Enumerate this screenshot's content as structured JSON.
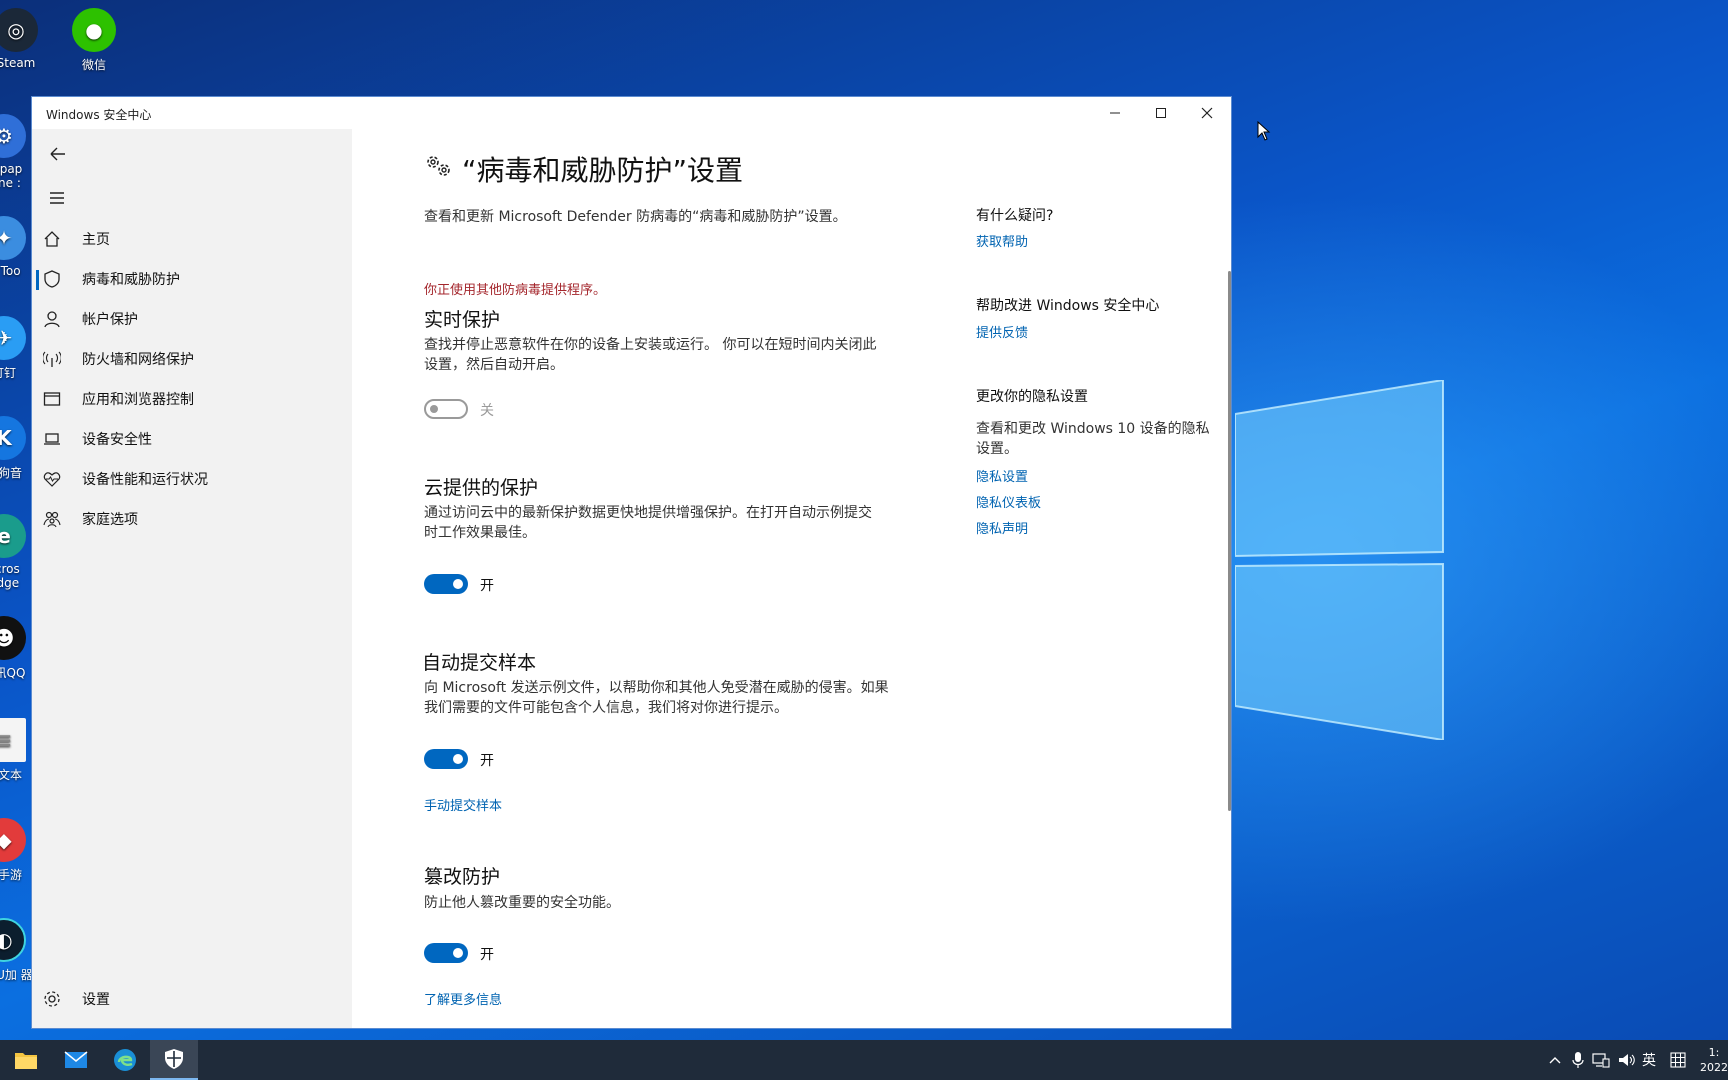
{
  "desktop": {
    "icons": [
      {
        "label": "Steam"
      },
      {
        "label": "微信"
      },
      {
        "label": "allpap gine :"
      },
      {
        "label": "tt Too"
      },
      {
        "label": "钉钉"
      },
      {
        "label": "酷狗音"
      },
      {
        "label": "licros Edge"
      },
      {
        "label": "腾讯QQ"
      },
      {
        "label": "建文本"
      },
      {
        "label": "讯手游"
      },
      {
        "label": "易UU加 器"
      }
    ]
  },
  "window": {
    "title": "Windows 安全中心"
  },
  "sidebar": {
    "items": [
      {
        "label": "主页",
        "icon": "home-icon"
      },
      {
        "label": "病毒和威胁防护",
        "icon": "shield-icon"
      },
      {
        "label": "帐户保护",
        "icon": "person-icon"
      },
      {
        "label": "防火墙和网络保护",
        "icon": "antenna-icon"
      },
      {
        "label": "应用和浏览器控制",
        "icon": "browser-window-icon"
      },
      {
        "label": "设备安全性",
        "icon": "laptop-icon"
      },
      {
        "label": "设备性能和运行状况",
        "icon": "heart-pulse-icon"
      },
      {
        "label": "家庭选项",
        "icon": "family-icon"
      }
    ],
    "settings_label": "设置"
  },
  "main": {
    "title": "“病毒和威胁防护”设置",
    "subtitle": "查看和更新 Microsoft Defender 防病毒的“病毒和威胁防护”设置。",
    "warning": "你正使用其他防病毒提供程序。",
    "sections": [
      {
        "title": "实时保护",
        "desc_line1": "查找并停止恶意软件在你的设备上安装或运行。 你可以在短时间内关闭此",
        "desc_line2": "设置，然后自动开启。",
        "state": "关",
        "on": false
      },
      {
        "title": "云提供的保护",
        "desc_line1": "通过访问云中的最新保护数据更快地提供增强保护。在打开自动示例提交",
        "desc_line2": "时工作效果最佳。",
        "state": "开",
        "on": true
      },
      {
        "title": "自动提交样本",
        "desc_line1": "向 Microsoft 发送示例文件，以帮助你和其他人免受潜在威胁的侵害。如果",
        "desc_line2": "我们需要的文件可能包含个人信息，我们将对你进行提示。",
        "state": "开",
        "on": true,
        "link": "手动提交样本"
      },
      {
        "title": "篡改防护",
        "desc_line1": "防止他人篡改重要的安全功能。",
        "state": "开",
        "on": true,
        "link": "了解更多信息"
      }
    ]
  },
  "right_panel": {
    "q_title": "有什么疑问?",
    "q_link": "获取帮助",
    "improve_title": "帮助改进 Windows 安全中心",
    "improve_link": "提供反馈",
    "privacy_title": "更改你的隐私设置",
    "privacy_desc_line1": "查看和更改 Windows 10 设备的隐私",
    "privacy_desc_line2": "设置。",
    "privacy_links": [
      "隐私设置",
      "隐私仪表板",
      "隐私声明"
    ]
  },
  "taskbar": {
    "ime": "英",
    "clock_top": "1:",
    "clock_bottom": "2022"
  },
  "colors": {
    "accent": "#0067c0",
    "link": "#0063b1",
    "warning": "#a4262c",
    "sidebar_bg": "#f2f2f2",
    "taskbar_bg": "#1f2b3a"
  }
}
